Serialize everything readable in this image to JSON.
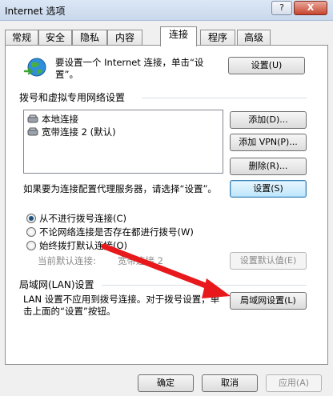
{
  "window": {
    "title": "Internet 选项",
    "help_label": "?",
    "close_label": "X"
  },
  "tabs": [
    {
      "label": "常规"
    },
    {
      "label": "安全"
    },
    {
      "label": "隐私"
    },
    {
      "label": "内容"
    },
    {
      "label": "连接"
    },
    {
      "label": "程序"
    },
    {
      "label": "高级"
    }
  ],
  "setup": {
    "text": "要设置一个 Internet 连接，单击“设置”。",
    "button": "设置(U)"
  },
  "dialup": {
    "group_title": "拨号和虚拟专用网络设置",
    "items": [
      {
        "label": "本地连接"
      },
      {
        "label": "宽带连接 2 (默认)"
      }
    ],
    "add_button": "添加(D)...",
    "add_vpn_button": "添加 VPN(P)...",
    "delete_button": "删除(R)...",
    "proxy_text": "如果要为连接配置代理服务器，请选择“设置”。",
    "settings_button": "设置(S)",
    "radios": [
      {
        "label": "从不进行拨号连接(C)",
        "selected": true
      },
      {
        "label": "不论网络连接是否存在都进行拨号(W)",
        "selected": false
      },
      {
        "label": "始终拨打默认连接(O)",
        "selected": false
      }
    ],
    "current_default_label": "当前默认连接:",
    "current_default_value": "宽带连接 2",
    "set_default_button": "设置默认值(E)"
  },
  "lan": {
    "group_title": "局域网(LAN)设置",
    "text": "LAN 设置不应用到拨号连接。对于拨号设置，单击上面的“设置”按钮。",
    "button": "局域网设置(L)"
  },
  "footer": {
    "ok": "确定",
    "cancel": "取消",
    "apply": "应用(A)"
  },
  "colors": {
    "arrow": "#e8191c",
    "accent": "#3c7fb1"
  }
}
